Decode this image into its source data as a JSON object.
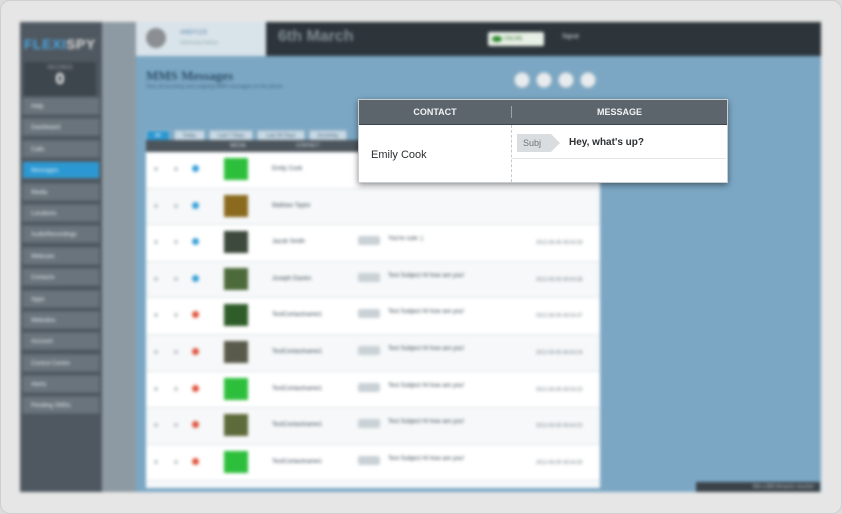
{
  "app": {
    "logo_part1": "FLEXI",
    "logo_part2": "SPY",
    "counter_label": "RECORDS",
    "counter_value": "0",
    "date": "6th March",
    "online_label": "ONLINE",
    "signal_label": "Signal"
  },
  "user": {
    "name": "ANDY123",
    "subtitle": "Samsung Galaxy"
  },
  "sidebar": {
    "items": [
      {
        "label": "Help"
      },
      {
        "label": "Dashboard"
      },
      {
        "label": "Calls"
      },
      {
        "label": "Messages",
        "active": true
      },
      {
        "label": "Media"
      },
      {
        "label": "Locations"
      },
      {
        "label": "AudioRecordings"
      },
      {
        "label": "Webcam"
      },
      {
        "label": "Contacts"
      },
      {
        "label": "Apps"
      },
      {
        "label": "Websites"
      },
      {
        "label": "Account"
      },
      {
        "label": "Control Centre"
      },
      {
        "label": "Alerts"
      },
      {
        "label": "Pending SMSs"
      }
    ]
  },
  "main": {
    "title": "MMS Messages",
    "subtitle": "View all incoming and outgoing MMS messages on the phone",
    "filters": [
      {
        "label": "All",
        "active": true
      },
      {
        "label": "Today"
      },
      {
        "label": "Last 7 Days"
      },
      {
        "label": "Last 30 Days"
      },
      {
        "label": "Incoming"
      }
    ],
    "columns": {
      "media": "MEDIA",
      "contact": "CONTACT"
    },
    "rows": [
      {
        "contact": "Emily Cook",
        "direction": "in",
        "thumb": "#2dbf3c"
      },
      {
        "contact": "Mathew Taylor",
        "direction": "in",
        "thumb": "#8b6a1e"
      },
      {
        "contact": "Jacob Smith",
        "direction": "in",
        "thumb": "#3d4a3b",
        "message": "You're cute :)",
        "timestamp": "2012-06-05 06:54:39"
      },
      {
        "contact": "Joseph Davies",
        "direction": "in",
        "thumb": "#4d6a3a",
        "message": "Test Subject Hi how are you!",
        "timestamp": "2012-06-05 06:54:38"
      },
      {
        "contact": "TestContactname1",
        "direction": "out",
        "thumb": "#2f5d2a",
        "message": "Test Subject Hi how are you!",
        "timestamp": "2012-06-05 06:54:37"
      },
      {
        "contact": "TestContactname1",
        "direction": "out",
        "thumb": "#5a5a4a",
        "message": "Test Subject Hi how are you!",
        "timestamp": "2012-06-05 06:54:24"
      },
      {
        "contact": "TestContactname1",
        "direction": "out",
        "thumb": "#2dbf3c",
        "message": "Test Subject Hi how are you!",
        "timestamp": "2012-06-05 06:54:23"
      },
      {
        "contact": "TestContactname1",
        "direction": "out",
        "thumb": "#5d6a3a",
        "message": "Test Subject Hi how are you!",
        "timestamp": "2012-06-05 06:54:22"
      },
      {
        "contact": "TestContactname1",
        "direction": "out",
        "thumb": "#2dbf3c",
        "message": "Test Subject Hi how are you!",
        "timestamp": "2012-06-05 06:54:20"
      }
    ]
  },
  "popup": {
    "header_contact": "CONTACT",
    "header_message": "MESSAGE",
    "contact": "Emily Cook",
    "subject_tag": "Subj",
    "message": "Hey, what's up?"
  },
  "footer": {
    "badge": "Win a $50 Amazon voucher"
  },
  "colors": {
    "accent": "#2b98d3",
    "incoming": "#3aa0d8",
    "outgoing": "#e0553e",
    "topbar": "#2d353b"
  }
}
